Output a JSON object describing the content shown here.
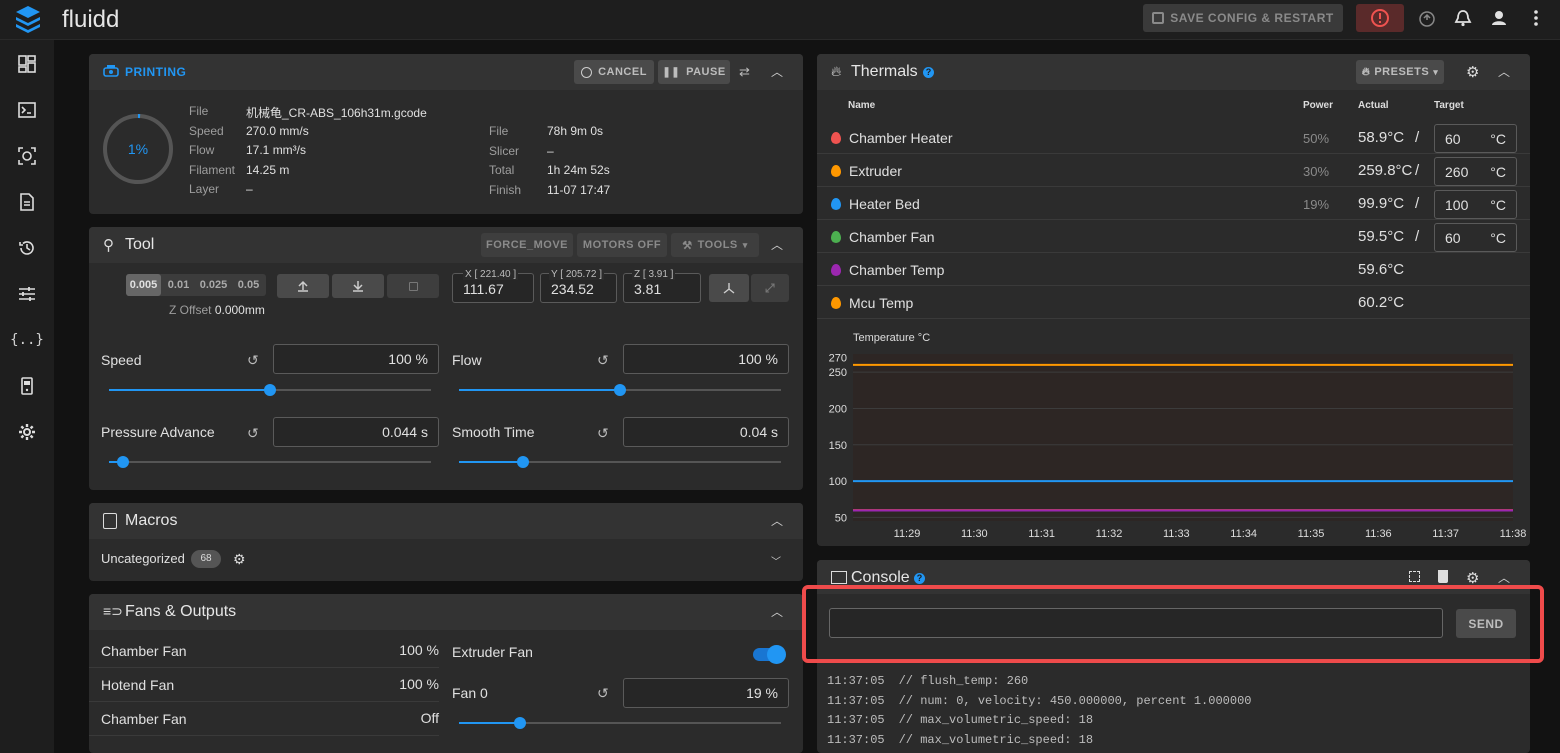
{
  "app": {
    "title": "fluidd"
  },
  "topbar": {
    "save_label": "SAVE CONFIG & RESTART"
  },
  "sidebar": {
    "items": [
      "dashboard-icon",
      "console-icon",
      "camera-icon",
      "file-icon",
      "history-icon",
      "tune-icon",
      "macros-icon",
      "device-icon",
      "settings-icon"
    ]
  },
  "printing": {
    "title": "PRINTING",
    "cancel_label": "CANCEL",
    "pause_label": "PAUSE",
    "progress_text": "1%",
    "progress_fraction": 0.01,
    "left": [
      {
        "label": "File",
        "value": "机械龟_CR-ABS_106h31m.gcode"
      },
      {
        "label": "Speed",
        "value": "270.0 mm/s"
      },
      {
        "label": "Flow",
        "value": "17.1 mm³/s"
      },
      {
        "label": "Filament",
        "value": "14.25 m"
      },
      {
        "label": "Layer",
        "value": "–"
      }
    ],
    "right": [
      {
        "label": "File",
        "value": "78h 9m 0s"
      },
      {
        "label": "Slicer",
        "value": "–"
      },
      {
        "label": "Total",
        "value": "1h 24m 52s"
      },
      {
        "label": "Finish",
        "value": "11-07 17:47"
      }
    ]
  },
  "tool": {
    "title": "Tool",
    "force_move_label": "FORCE_MOVE",
    "motors_off_label": "MOTORS OFF",
    "tools_label": "TOOLS",
    "steps": [
      "0.005",
      "0.01",
      "0.025",
      "0.05"
    ],
    "z_offset_label": "Z Offset",
    "z_offset_value": "0.000mm",
    "x_label": "X [ 221.40 ]",
    "x_value": "111.67",
    "y_label": "Y [ 205.72 ]",
    "y_value": "234.52",
    "z_label": "Z [ 3.91 ]",
    "z_value": "3.81",
    "speed_label": "Speed",
    "speed_value": "100 %",
    "speed_fraction": 0.5,
    "flow_label": "Flow",
    "flow_value": "100 %",
    "flow_fraction": 0.5,
    "pa_label": "Pressure Advance",
    "pa_value": "0.044 s",
    "pa_fraction": 0.044,
    "smooth_label": "Smooth Time",
    "smooth_value": "0.04 s",
    "smooth_fraction": 0.2
  },
  "macros": {
    "title": "Macros",
    "category": "Uncategorized",
    "count": "68"
  },
  "fans": {
    "title": "Fans & Outputs",
    "left": [
      {
        "name": "Chamber Fan",
        "value": "100 %"
      },
      {
        "name": "Hotend Fan",
        "value": "100 %"
      },
      {
        "name": "Chamber Fan",
        "value": "Off"
      }
    ],
    "extruder_fan_label": "Extruder Fan",
    "fan0_label": "Fan 0",
    "fan0_value": "19 %",
    "fan0_fraction": 0.19
  },
  "thermals": {
    "title": "Thermals",
    "presets_label": "PRESETS",
    "col_name": "Name",
    "col_power": "Power",
    "col_actual": "Actual",
    "col_target": "Target",
    "rows": [
      {
        "name": "Chamber Heater",
        "power": "50%",
        "actual": "58.9°C",
        "target": "60",
        "unit": "°C",
        "color": "#ef5350"
      },
      {
        "name": "Extruder",
        "power": "30%",
        "actual": "259.8°C",
        "target": "260",
        "unit": "°C",
        "color": "#ff9800"
      },
      {
        "name": "Heater Bed",
        "power": "19%",
        "actual": "99.9°C",
        "target": "100",
        "unit": "°C",
        "color": "#2196f3"
      },
      {
        "name": "Chamber Fan",
        "power": "",
        "actual": "59.5°C",
        "target": "60",
        "unit": "°C",
        "color": "#4caf50"
      },
      {
        "name": "Chamber Temp",
        "power": "",
        "actual": "59.6°C",
        "target": "",
        "unit": "",
        "color": "#9c27b0"
      },
      {
        "name": "Mcu Temp",
        "power": "",
        "actual": "60.2°C",
        "target": "",
        "unit": "",
        "color": "#ff9800"
      }
    ]
  },
  "chart_data": {
    "type": "line",
    "title": "Temperature °C",
    "x": [
      "11:29",
      "11:30",
      "11:31",
      "11:32",
      "11:33",
      "11:34",
      "11:35",
      "11:36",
      "11:37",
      "11:38"
    ],
    "yticks": [
      50,
      100,
      150,
      200,
      250,
      270
    ],
    "ylim": [
      45,
      275
    ],
    "series": [
      {
        "values": [
          260,
          260,
          260,
          260,
          260,
          260,
          260,
          260,
          260,
          260
        ],
        "color": "#ff9800"
      },
      {
        "values": [
          100,
          100,
          100,
          100,
          100,
          100,
          100,
          100,
          100,
          100
        ],
        "color": "#2196f3"
      },
      {
        "values": [
          60,
          60,
          60,
          60,
          60,
          60,
          60,
          60,
          60,
          60
        ],
        "color": "#ef5350"
      },
      {
        "values": [
          59.5,
          59.5,
          59.5,
          59.5,
          59.5,
          59.5,
          59.5,
          59.5,
          59.5,
          59.5
        ],
        "color": "#9c27b0"
      }
    ]
  },
  "console": {
    "title": "Console",
    "send_label": "SEND",
    "lines": [
      {
        "time": "11:37:05",
        "text": "// flush_temp: 260"
      },
      {
        "time": "11:37:05",
        "text": "// num: 0, velocity: 450.000000, percent 1.000000"
      },
      {
        "time": "11:37:05",
        "text": "// max_volumetric_speed: 18"
      },
      {
        "time": "11:37:05",
        "text": "// max_volumetric_speed: 18"
      }
    ]
  }
}
